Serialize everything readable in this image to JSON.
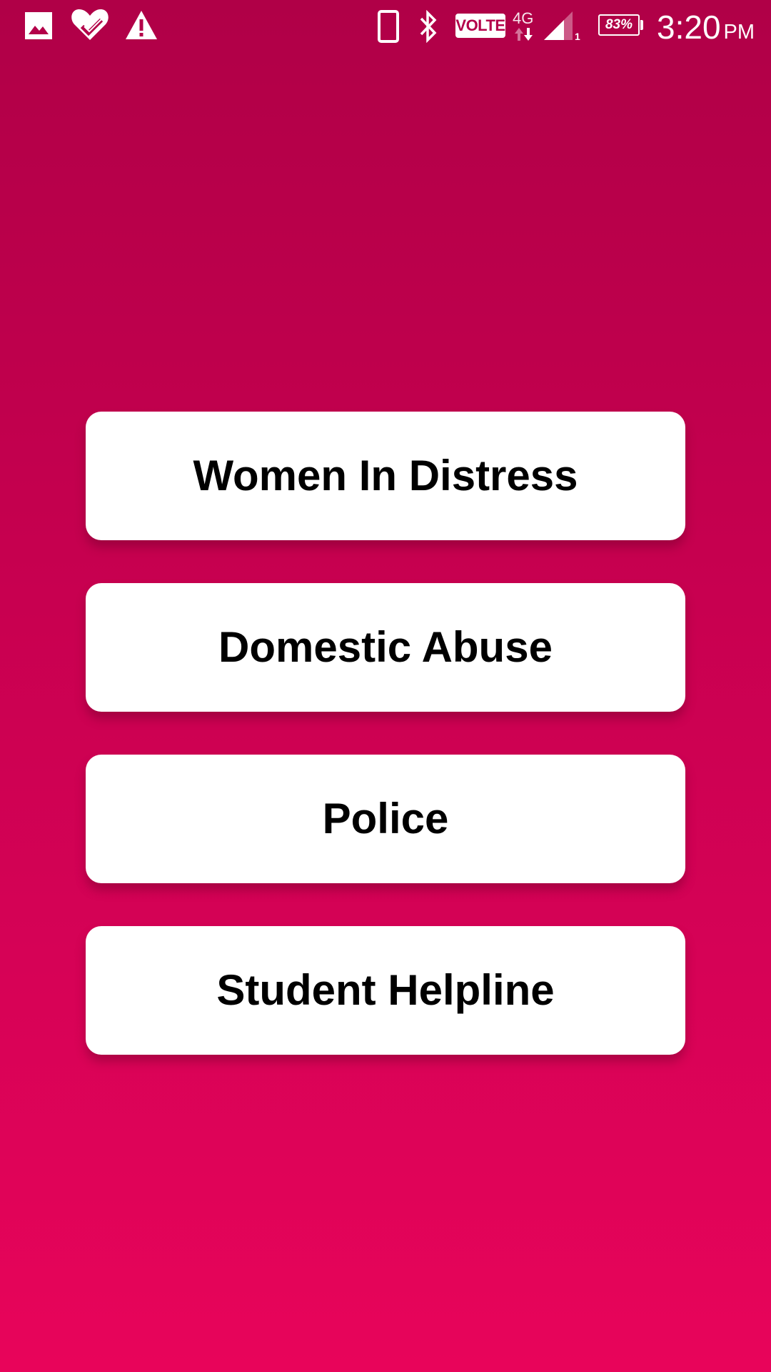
{
  "status_bar": {
    "left_icons": [
      "image-icon",
      "heart-check-icon",
      "warning-icon"
    ],
    "right_icons": [
      "phone-icon",
      "bluetooth-icon",
      "volte-badge",
      "network-4g-icon",
      "signal-icon",
      "battery-icon"
    ],
    "volte_label": "VOLTE",
    "network_type": "4G",
    "sim_slot": "1",
    "battery_percent_label": "83%",
    "battery_level": 0.83,
    "time": "3:20",
    "ampm": "PM"
  },
  "menu": {
    "buttons": [
      {
        "label": "Women In Distress"
      },
      {
        "label": "Domestic Abuse"
      },
      {
        "label": "Police"
      },
      {
        "label": "Student Helpline"
      }
    ]
  },
  "colors": {
    "background_top": "#b00047",
    "background_bottom": "#e8045a",
    "button_background": "#ffffff",
    "button_text": "#000000"
  }
}
